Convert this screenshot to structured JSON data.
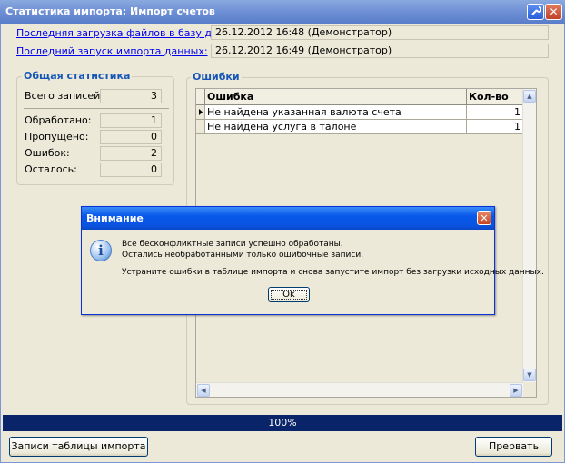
{
  "window": {
    "title": "Статистика импорта: Импорт счетов"
  },
  "info": {
    "last_files_load_label": "Последняя загрузка файлов в базу данных:",
    "last_files_load_value": "26.12.2012 16:48 (Демонстратор)",
    "last_import_label": "Последний запуск импорта данных:",
    "last_import_value": "26.12.2012 16:49 (Демонстратор)"
  },
  "stats": {
    "title": "Общая статистика",
    "total_label": "Всего записей:",
    "total_value": "3",
    "processed_label": "Обработано:",
    "processed_value": "1",
    "skipped_label": "Пропущено:",
    "skipped_value": "0",
    "errors_label": "Ошибок:",
    "errors_value": "2",
    "remaining_label": "Осталось:",
    "remaining_value": "0"
  },
  "errors": {
    "title": "Ошибки",
    "columns": [
      "Ошибка",
      "Кол-во"
    ],
    "rows": [
      {
        "error": "Не найдена указанная валюта счета",
        "count": "1"
      },
      {
        "error": "Не найдена услуга в талоне",
        "count": "1"
      }
    ]
  },
  "progress": {
    "label": "100%",
    "percent": 100,
    "color": "#0a246a"
  },
  "footer": {
    "records_button": "Записи таблицы импорта",
    "abort_button": "Прервать"
  },
  "dialog": {
    "title": "Внимание",
    "line1": "Все бесконфликтные записи успешно обработаны.",
    "line2": "Остались необработанными только ошибочные записи.",
    "line3": "Устраните ошибки в таблице импорта и снова запустите импорт без загрузки исходных данных.",
    "ok": "Ok",
    "icon": "info-icon"
  },
  "colors": {
    "window_bg": "#ece9d8",
    "group_title": "#1556b8",
    "link": "#0000ee",
    "dialog_title": "#0a54e2"
  }
}
